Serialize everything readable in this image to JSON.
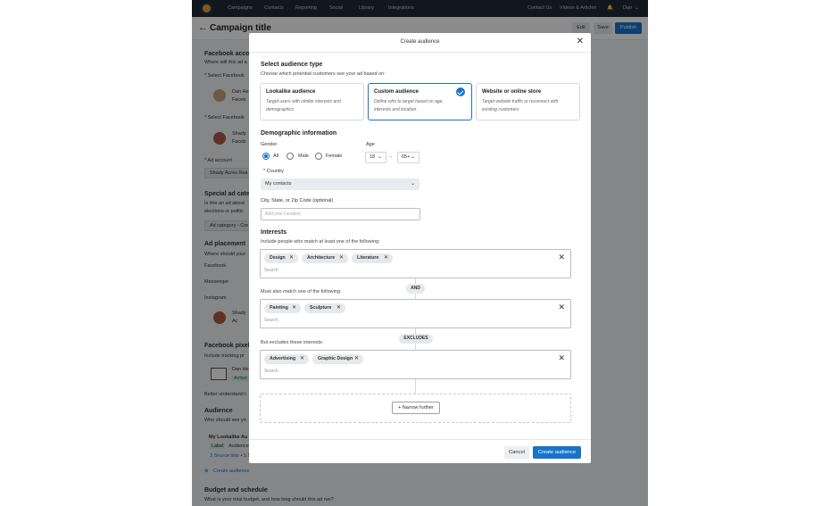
{
  "topnav": {
    "items": [
      "Campaigns",
      "Contacts",
      "Reporting",
      "Social",
      "Library",
      "Integrations"
    ],
    "contact_us": "Contact Us",
    "videos": "Videos & Articles",
    "user": "Dan"
  },
  "titlebar": {
    "back_icon": "←",
    "title": "Campaign title",
    "edit": "Edit",
    "save": "Save",
    "publish": "Publish"
  },
  "background": {
    "fb_account_title": "Facebook acco",
    "fb_account_sub": "Where will this ad a",
    "select_fb_1": "* Select Facebook",
    "user_name_1": "Dan He",
    "user_sub_1": "Faceb",
    "select_fb_2": "* Select Facebook",
    "page_name": "Shady",
    "page_sub": "Faceb",
    "ad_account_label": "* Ad account",
    "ad_account_value": "Shady Acres Rea",
    "special_title": "Special ad cate",
    "special_sub_1": "Is this an ad about",
    "special_sub_2": "elections or politic",
    "ad_category_value": "Ad category - Cre",
    "placement_title": "Ad placement",
    "placement_sub": "Where should your",
    "placement_facebook": "Facebook",
    "placement_messenger": "Messenger",
    "placement_instagram": "Instagram",
    "insta_name": "Shady",
    "insta_sub": "Ac",
    "pixel_title": "Facebook pixel",
    "pixel_sub": "Include tracking pr",
    "pixel_name": "Dan He",
    "pixel_active": "Active",
    "better_understand": "Better understand t",
    "audience_title": "Audience",
    "audience_sub": "Who should see yo",
    "lookalike_name": "My Lookalike Au",
    "label_badge": "Label",
    "audience_word": "Audience",
    "source_lists": "3 Source lists • 5.5",
    "create_audience_link": "Create audience",
    "budget_title": "Budget and schedule",
    "budget_sub": "What is your total budget, and how long should this ad run?"
  },
  "modal": {
    "title": "Create audience",
    "close_icon": "✕",
    "select_type_title": "Select audience type",
    "select_type_sub": "Choose which potential customers see your ad based on:",
    "cards": [
      {
        "title": "Lookalike audience",
        "desc": "Target users with similar interests and demographics"
      },
      {
        "title": "Custom audience",
        "desc": "Define who to target based on age, interests and location."
      },
      {
        "title": "Website or online store",
        "desc": "Target website traffic or reconnect with existing customers"
      }
    ],
    "selected_card": "Custom audience",
    "demographic_title": "Demographic information",
    "gender_label": "Gender",
    "gender_options": [
      "All",
      "Male",
      "Female"
    ],
    "gender_selected": "All",
    "age_label": "Age",
    "age_min": "18",
    "age_dash": "-",
    "age_max": "65+",
    "country_label": "* Country",
    "country_value": "My contacts",
    "city_label": "City, State, or Zip Code (optional)",
    "city_placeholder": "Add new Location",
    "interests_title": "Interests",
    "interests_sub": "Include people who match at least one of the following:",
    "group1": [
      "Design",
      "Architecture",
      "Literature"
    ],
    "and_label": "AND",
    "must_match_label": "Must also match one of the following:",
    "group2": [
      "Painting",
      "Sculpture"
    ],
    "excludes_label": "EXCLUDES",
    "excludes_sub": "But excludes these interests:",
    "group3": [
      "Advertising",
      "Graphic Design"
    ],
    "search_placeholder": "Search",
    "narrow_further": "+ Narrow further",
    "cancel": "Cancel",
    "create": "Create audience"
  },
  "colors": {
    "primary": "#1a73c9",
    "nav_bg": "#1f2a3a",
    "active_badge": "#d8f0df"
  }
}
